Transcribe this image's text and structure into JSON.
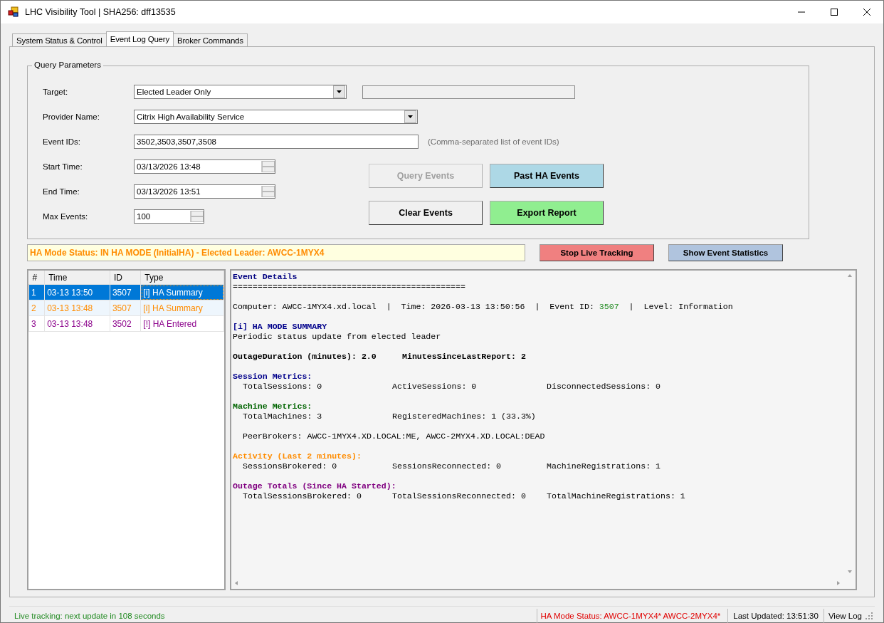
{
  "window": {
    "title": "LHC Visibility Tool | SHA256: dff13535"
  },
  "tabs": [
    {
      "label": "System Status & Control",
      "selected": false
    },
    {
      "label": "Event Log Query",
      "selected": true
    },
    {
      "label": "Broker Commands",
      "selected": false
    }
  ],
  "query_parameters": {
    "title": "Query Parameters",
    "target": {
      "label": "Target:",
      "value": "Elected Leader Only"
    },
    "provider_name": {
      "label": "Provider Name:",
      "value": "Citrix High Availability Service"
    },
    "event_ids": {
      "label": "Event IDs:",
      "value": "3502,3503,3507,3508",
      "hint": "(Comma-separated list of event IDs)"
    },
    "start_time": {
      "label": "Start Time:",
      "value": "03/13/2026 13:48"
    },
    "end_time": {
      "label": "End Time:",
      "value": "03/13/2026 13:51"
    },
    "max_events": {
      "label": "Max Events:",
      "value": "100"
    },
    "buttons": [
      {
        "label": "Query Events",
        "disabled": true,
        "color": "#f0f0f0"
      },
      {
        "label": "Past HA Events",
        "disabled": false,
        "color": "#add8e6"
      },
      {
        "label": "Clear Events",
        "disabled": false,
        "color": "#f0f0f0"
      },
      {
        "label": "Export Report",
        "disabled": false,
        "color": "#90ee90"
      }
    ]
  },
  "ha_status": "HA Mode Status: IN HA MODE (InitialHA) - Elected Leader: AWCC-1MYX4",
  "actions": [
    {
      "label": "Stop Live Tracking",
      "color": "#f08080"
    },
    {
      "label": "Show Event Statistics",
      "color": "#b0c4de"
    }
  ],
  "event_table": {
    "columns": [
      "#",
      "Time",
      "ID",
      "Type"
    ],
    "rows": [
      {
        "cells": [
          "1",
          "03-13 13:50",
          "3507",
          "[i] HA Summary"
        ],
        "selected": true
      },
      {
        "cells": [
          "2",
          "03-13 13:48",
          "3507",
          "[i] HA Summary"
        ],
        "selected": false,
        "color": "#ff8c00"
      },
      {
        "cells": [
          "3",
          "03-13 13:48",
          "3502",
          "[!] HA Entered"
        ],
        "selected": false,
        "color": "#8b008b"
      }
    ]
  },
  "event_details": {
    "sections": [
      {
        "lines": [
          {
            "kind": "heading",
            "color": "#000080",
            "text": "Event Details"
          },
          {
            "kind": "plain",
            "text": "==============================================="
          }
        ]
      },
      {
        "lines": [
          {
            "kind": "parts",
            "parts": [
              {
                "kind": "plain",
                "text": "Computer: AWCC-1MYX4.xd.local  |  Time: 2026-03-13 13:50:56  |  Event ID: "
              },
              {
                "kind": "value",
                "text": "3507"
              },
              {
                "kind": "plain",
                "text": "  |  Level: Information"
              }
            ]
          }
        ]
      },
      {
        "lines": [
          {
            "kind": "heading",
            "color": "#00008b",
            "text": "[i] HA MODE SUMMARY"
          },
          {
            "kind": "plain",
            "text": "Periodic status update from elected leader"
          }
        ]
      },
      {
        "lines": [
          {
            "kind": "columns",
            "bold": true,
            "columns": [
              "OutageDuration (minutes): 2.0",
              "MinutesSinceLastReport: 2"
            ]
          }
        ]
      },
      {
        "lines": [
          {
            "kind": "heading",
            "color": "#00008b",
            "text": "Session Metrics:"
          },
          {
            "kind": "columns",
            "bold": false,
            "columns": [
              "TotalSessions: 0",
              "ActiveSessions: 0",
              "DisconnectedSessions: 0"
            ]
          }
        ]
      },
      {
        "lines": [
          {
            "kind": "heading",
            "color": "#006400",
            "text": "Machine Metrics:"
          },
          {
            "kind": "columns",
            "bold": false,
            "columns": [
              "TotalMachines: 3",
              "RegisteredMachines: 1 (33.3%)"
            ]
          }
        ]
      },
      {
        "lines": [
          {
            "kind": "columns",
            "bold": false,
            "columns": [
              "PeerBrokers: AWCC-1MYX4.XD.LOCAL:ME, AWCC-2MYX4.XD.LOCAL:DEAD"
            ]
          }
        ]
      },
      {
        "lines": [
          {
            "kind": "heading",
            "color": "#ff8c00",
            "text": "Activity (Last 2 minutes):"
          },
          {
            "kind": "columns",
            "bold": false,
            "columns": [
              "SessionsBrokered: 0",
              "SessionsReconnected: 0",
              "MachineRegistrations: 1"
            ]
          }
        ]
      },
      {
        "lines": [
          {
            "kind": "heading",
            "color": "#800080",
            "text": "Outage Totals (Since HA Started):"
          },
          {
            "kind": "columns",
            "bold": false,
            "columns": [
              "TotalSessionsBrokered: 0",
              "TotalSessionsReconnected: 0",
              "TotalMachineRegistrations: 1"
            ]
          }
        ]
      }
    ]
  },
  "status_bar": {
    "tracking": "Live tracking: next update in 108 seconds",
    "ha_mode": "HA Mode Status: AWCC-1MYX4* AWCC-2MYX4*",
    "last_updated": "Last Updated: 13:51:30",
    "view_log": "View Log"
  }
}
